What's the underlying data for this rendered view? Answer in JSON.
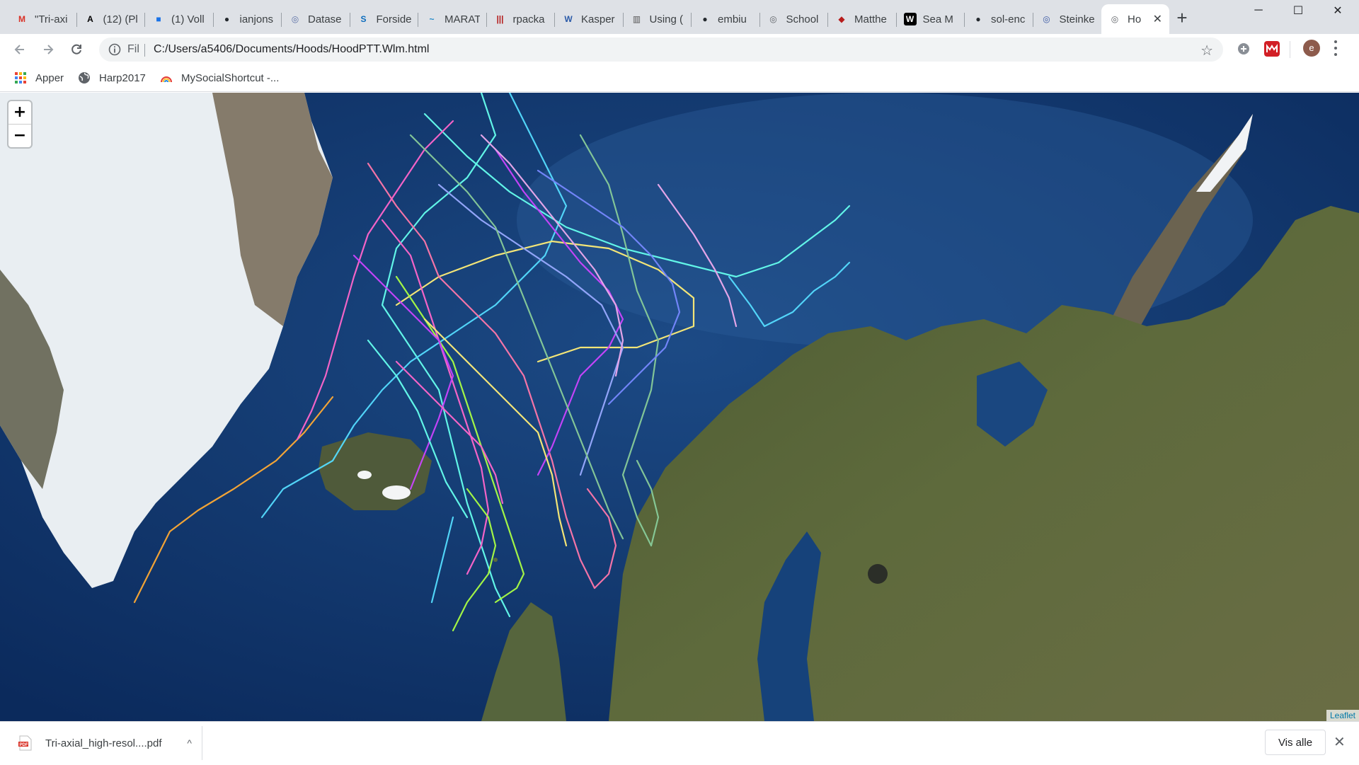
{
  "tabs": [
    {
      "title": "\"Tri-axi",
      "icon": "gmail-icon",
      "color": "#d93025"
    },
    {
      "title": "(12) (Pl",
      "icon": "academia-icon",
      "color": "#000000"
    },
    {
      "title": "(1) Voll",
      "icon": "teams-icon",
      "color": "#1a73e8"
    },
    {
      "title": "ianjons",
      "icon": "github-icon",
      "color": "#24292e"
    },
    {
      "title": "Datase",
      "icon": "globe-icon",
      "color": "#5b6fa6"
    },
    {
      "title": "Forside",
      "icon": "sharepoint-icon",
      "color": "#0b6cbd"
    },
    {
      "title": "MARAT",
      "icon": "dolphin-icon",
      "color": "#1e88c8"
    },
    {
      "title": "rpacka",
      "icon": "rpackages-icon",
      "color": "#b31b1b"
    },
    {
      "title": "Kasper",
      "icon": "wave-icon",
      "color": "#2a5aa8"
    },
    {
      "title": "Using (",
      "icon": "chart-icon",
      "color": "#555555"
    },
    {
      "title": "embiu",
      "icon": "github-icon",
      "color": "#24292e"
    },
    {
      "title": "School",
      "icon": "globe-icon",
      "color": "#5f6368"
    },
    {
      "title": "Matthe",
      "icon": "shield-icon",
      "color": "#b71c1c"
    },
    {
      "title": "Sea M",
      "icon": "w-icon",
      "color": "#000000"
    },
    {
      "title": "sol-enc",
      "icon": "github-icon",
      "color": "#24292e"
    },
    {
      "title": "Steinke",
      "icon": "globe-icon",
      "color": "#3b5aa5"
    },
    {
      "title": "Ho",
      "icon": "globe-icon",
      "color": "#5f6368",
      "active": true
    }
  ],
  "new_tab_label": "+",
  "window_controls": {
    "minimize": "─",
    "maximize": "☐",
    "close": "✕"
  },
  "omnibox": {
    "scheme": "Fil",
    "url": "C:/Users/a5406/Documents/Hoods/HoodPTT.Wlm.html"
  },
  "profile_initial": "e",
  "bookmarks": [
    {
      "label": "Apper",
      "icon": "apps-grid-icon"
    },
    {
      "label": "Harp2017",
      "icon": "globe-icon"
    },
    {
      "label": "MySocialShortcut -...",
      "icon": "rainbow-icon"
    }
  ],
  "map": {
    "zoom_in": "+",
    "zoom_out": "−",
    "attribution": "Leaflet",
    "track_colors": [
      "#ff66cc",
      "#cc44ff",
      "#66ffee",
      "#aaff44",
      "#ffaa33",
      "#99aaff",
      "#ffee77",
      "#7788ff",
      "#ff77aa",
      "#88cc99",
      "#55ddff",
      "#eeaaee"
    ]
  },
  "download": {
    "filename": "Tri-axial_high-resol....pdf",
    "caret": "^",
    "show_all": "Vis alle",
    "close": "✕"
  }
}
